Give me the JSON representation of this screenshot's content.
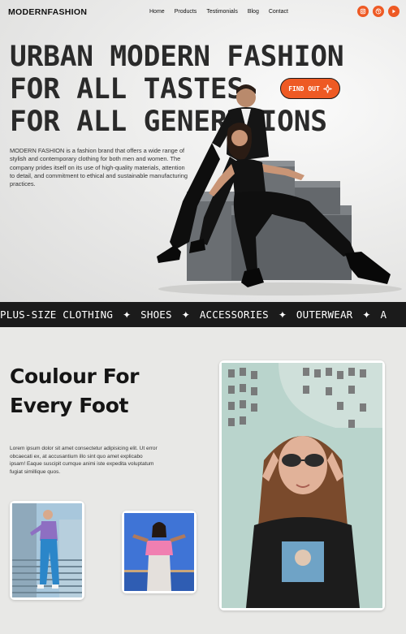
{
  "nav": {
    "brand": "MODERNFASHION",
    "links": [
      "Home",
      "Products",
      "Testimonials",
      "Blog",
      "Contact"
    ],
    "social_icons": [
      "instagram-icon",
      "dribbble-icon",
      "behance-icon"
    ]
  },
  "hero": {
    "headline": [
      "URBAN MODERN FASHION",
      "FOR ALL TASTES",
      "FOR ALL GENERATIONS"
    ],
    "cta_label": "FIND OUT",
    "cta_icon": "sparkle-icon",
    "intro": "MODERN FASHION is a fashion brand that offers a wide range of stylish and contemporary clothing for both men and women. The company prides itself on its use of high-quality materials, attention to detail, and commitment to ethical and sustainable manufacturing practices."
  },
  "ticker": {
    "items": [
      "PLUS-SIZE CLOTHING",
      "SHOES",
      "ACCESSORIES",
      "OUTERWEAR",
      "A"
    ],
    "separator": "✦"
  },
  "section2": {
    "title_line1": "Coulour For",
    "title_line2": "Every Foot",
    "body": "Lorem ipsum dolor sit amet consectetur adipisicing elit. Ut error obcaecati ex, at accusantium illo sint quo amet explicabo ipsam! Eaque suscipit cumque animi iste expedita voluptatum fugiat simillique quos."
  },
  "colors": {
    "accent": "#ee5a24",
    "dark": "#1b1b1b",
    "background": "#e8e8e6"
  }
}
